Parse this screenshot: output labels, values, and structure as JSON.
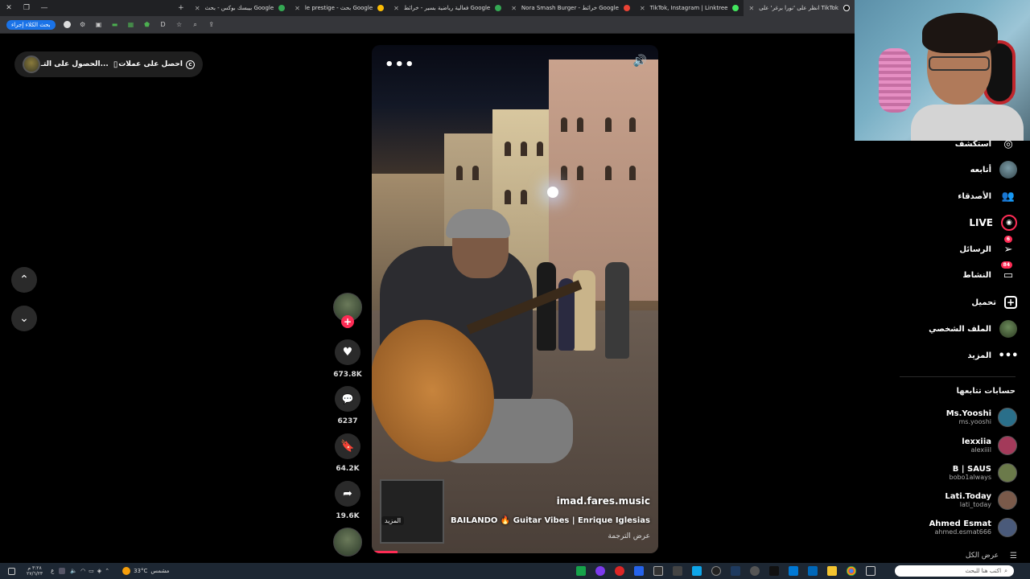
{
  "browser": {
    "tabs": [
      {
        "title": "",
        "fav": "#4285f4"
      },
      {
        "title": "بيبسك بوكس - بحث Google",
        "fav": "#34a853"
      },
      {
        "title": "le prestige - بحث Google",
        "fav": "#fbbc05"
      },
      {
        "title": "فعالية رياضية بسير - خرائط Google",
        "fav": "#34a853"
      },
      {
        "title": "Nora Smash Burger - خرائط Google",
        "fav": "#ea4335"
      },
      {
        "title": "TikTok, Instagram | Linktree",
        "fav": "#43e55e"
      },
      {
        "title": "انظر على 'نورا برغر' على TikTok",
        "fav": "#111111"
      }
    ],
    "new_tab": "+",
    "bookmarks_search": "بحث الكلاء إجراء"
  },
  "top_pill": {
    "get_coins": "احصل على عملات",
    "get_app": "الحصول على التـ..."
  },
  "nav": {
    "up": "⌃",
    "down": "⌄"
  },
  "video": {
    "more": "•••",
    "sound": "🔊",
    "author": "imad.fares.music",
    "caption": "BAILANDO 🔥 Guitar Vibes | Enrique Iglesias",
    "translate": "عرض الترجمة",
    "more_tag": "المزيد",
    "progress": 0.09
  },
  "actions": {
    "like_count": "673.8K",
    "comment_count": "6237",
    "save_count": "64.2K",
    "share_count": "19.6K"
  },
  "sidebar": {
    "explore": "استكشف",
    "following": "أتابعه",
    "friends": "الأصدقاء",
    "live": "LIVE",
    "messages": "الرسائل",
    "messages_badge": "6",
    "activity": "النشاط",
    "activity_badge": "84",
    "upload": "تحميل",
    "profile": "الملف الشخصي",
    "more": "المزيد",
    "following_accounts_title": "حسابات تتابعها",
    "accounts": [
      {
        "name": "Ms.Yooshi",
        "handle": "ms.yooshi",
        "color": "#2a6f8a"
      },
      {
        "name": "lexxiia",
        "handle": "alexiiil",
        "color": "#a33a5a"
      },
      {
        "name": "B | SAUS",
        "handle": "bobo1always",
        "color": "#6b7a4a"
      },
      {
        "name": "Lati.Today",
        "handle": "lati_today",
        "color": "#7a5a4a"
      },
      {
        "name": "Ahmed Esmat",
        "handle": "ahmed.esmat666",
        "color": "#4a5a7a"
      }
    ],
    "see_all": "عرض الكل"
  },
  "taskbar": {
    "search_placeholder": "اكتب هنا للبحث",
    "weather_temp": "33°C",
    "weather_desc": "مشمس",
    "time": "٣:٢٨ م",
    "date": "٢٧/٦/٢٣"
  }
}
